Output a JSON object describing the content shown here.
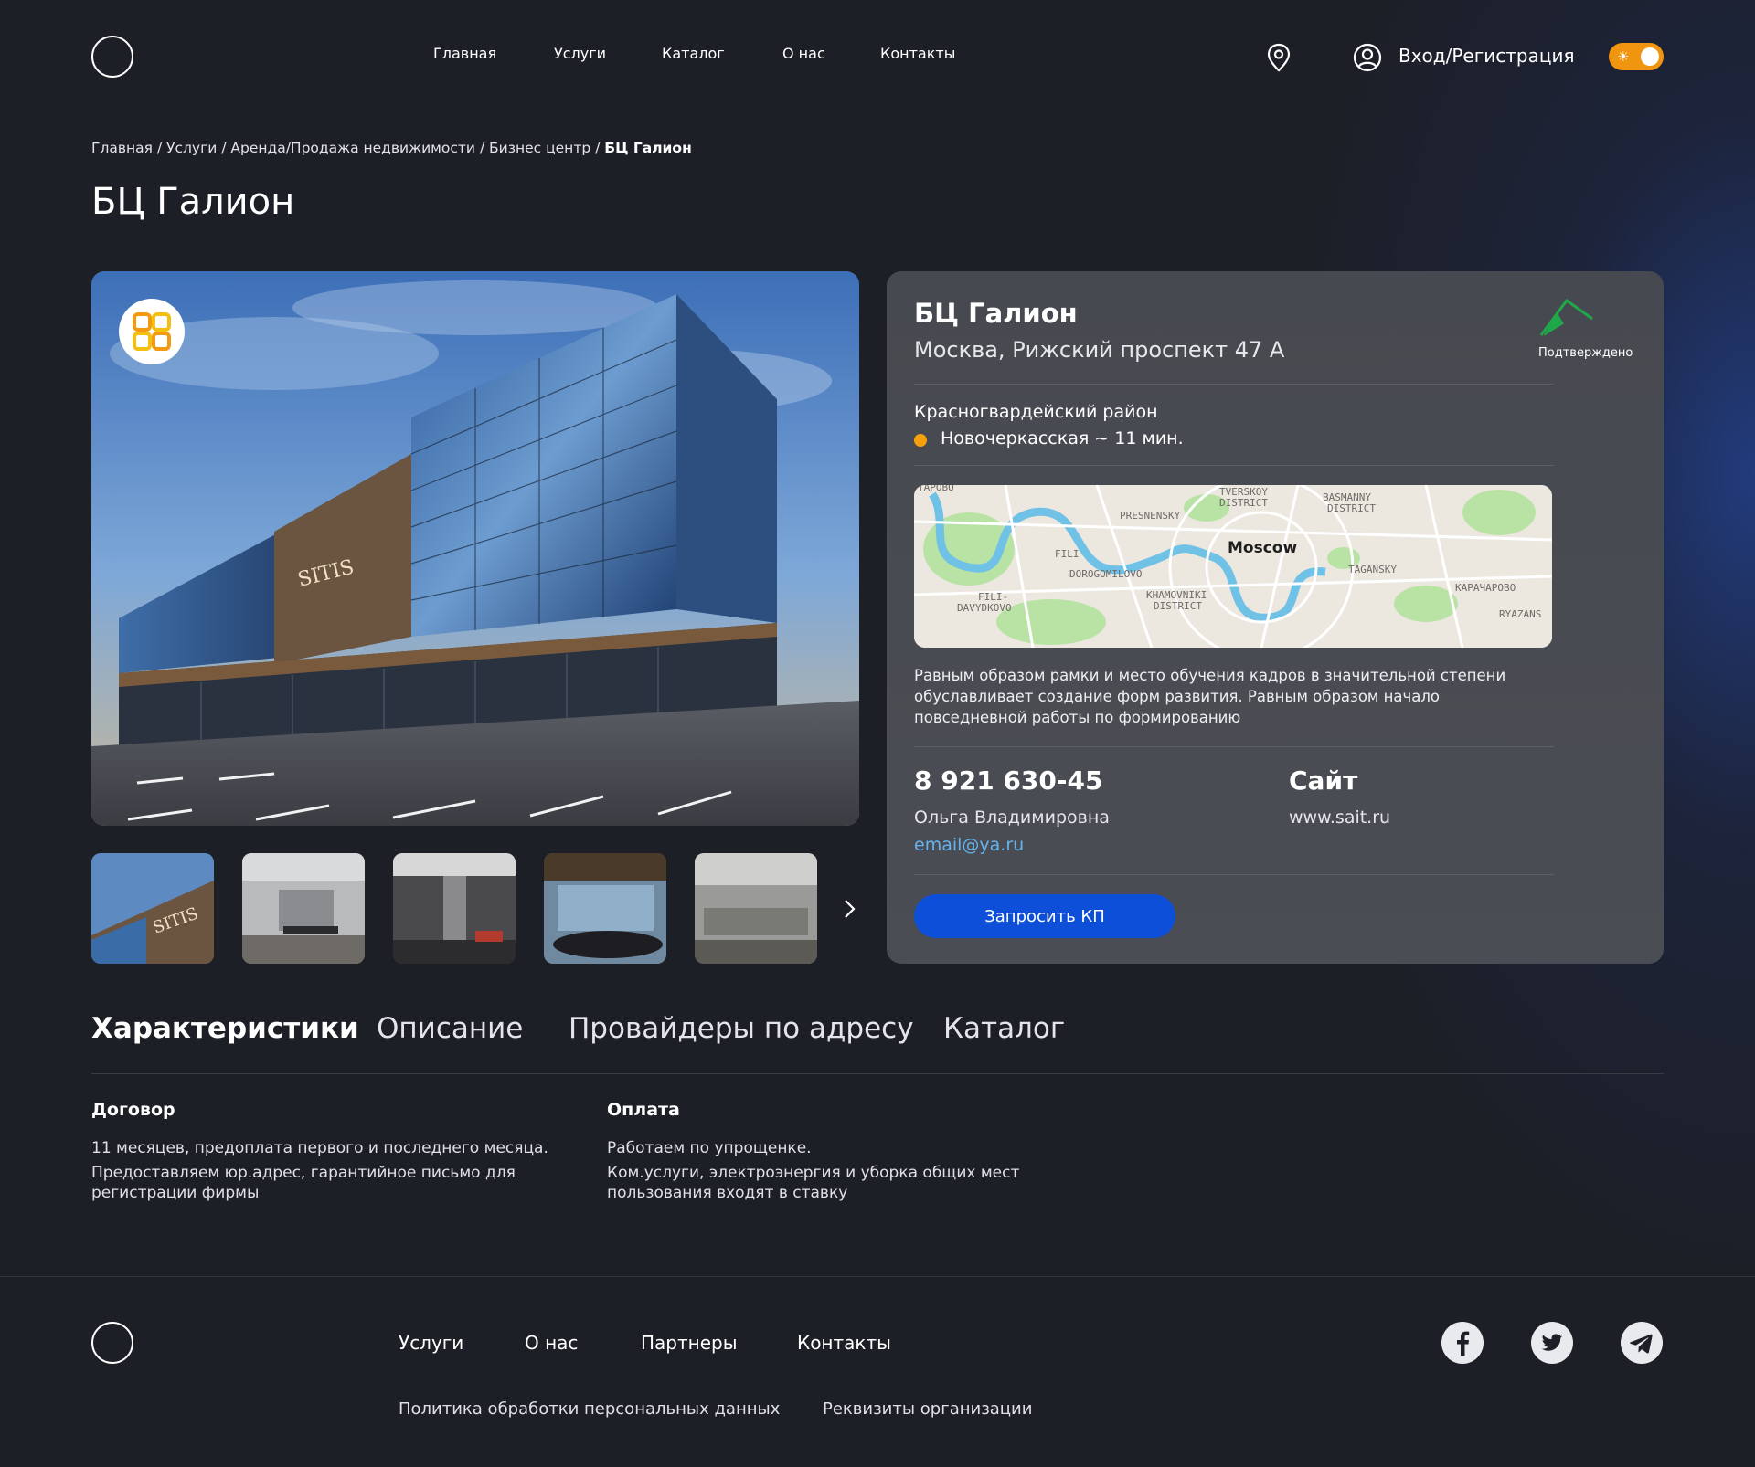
{
  "header": {
    "nav": [
      "Главная",
      "Услуги",
      "Каталог",
      "О нас",
      "Контакты"
    ],
    "login": "Вход/Регистрация",
    "icons": [
      "location-pin-icon",
      "user-icon",
      "sun-icon"
    ],
    "theme_toggle_color": "#f0950f"
  },
  "breadcrumb": {
    "items": [
      "Главная",
      "Услуги",
      "Аренда/Продажа недвижимости",
      "Бизнес центр"
    ],
    "current": "БЦ Галион"
  },
  "page_title": "БЦ Галион",
  "gallery": {
    "building_sign": "SITIS",
    "thumbs": 5
  },
  "card": {
    "name": "БЦ Галион",
    "address": "Москва, Рижский проспект 47 А",
    "verified": "Подтверждено",
    "district": "Красногвардейский район",
    "metro": "Новочеркасская ~ 11 мин.",
    "metro_color": "#f5a00f",
    "map": {
      "city": "Moscow",
      "labels": [
        "TVERSKOY",
        "DISTRICT",
        "BASMANNY",
        "DISTRICT",
        "PRESNENSKY",
        "FILI",
        "DOROGOMILOVO",
        "TAGANSKY",
        "FILI-",
        "DAVYDKOVO",
        "KHAMOVNIKI",
        "DISTRICT",
        "КАРАЧАРОВО",
        "RYAZANS",
        "ТАРОВО"
      ]
    },
    "description": [
      "Равным образом рамки и место обучения кадров в значительной степени",
      "обуславливает создание форм развития. Равным образом начало",
      "повседневной работы по формированию"
    ],
    "phone": "8 921 630-45",
    "contact_person": "Ольга Владимировна",
    "email": "email@ya.ru",
    "site_label": "Сайт",
    "site_url": "www.sait.ru",
    "cta": "Запросить КП",
    "cta_color": "#0d4fd9"
  },
  "tabs": [
    {
      "label": "Характеристики",
      "active": true
    },
    {
      "label": "Описание",
      "active": false
    },
    {
      "label": "Провайдеры по адресу",
      "active": false
    },
    {
      "label": "Каталог",
      "active": false
    }
  ],
  "specs": [
    {
      "title": "Договор",
      "lines": [
        "11 месяцев, предоплата первого и последнего месяца.",
        "Предоставляем юр.адрес, гарантийное письмо для",
        "регистрации фирмы"
      ]
    },
    {
      "title": "Оплата",
      "lines": [
        "Работаем по упрощенке.",
        "Ком.услуги, электроэнергия и уборка общих мест",
        "пользования входят в ставку"
      ]
    }
  ],
  "footer": {
    "nav": [
      "Услуги",
      "О нас",
      "Партнеры",
      "Контакты"
    ],
    "links": [
      "Политика обработки персональных данных",
      "Реквизиты организации"
    ],
    "social_icons": [
      "facebook-icon",
      "twitter-icon",
      "telegram-icon"
    ]
  }
}
